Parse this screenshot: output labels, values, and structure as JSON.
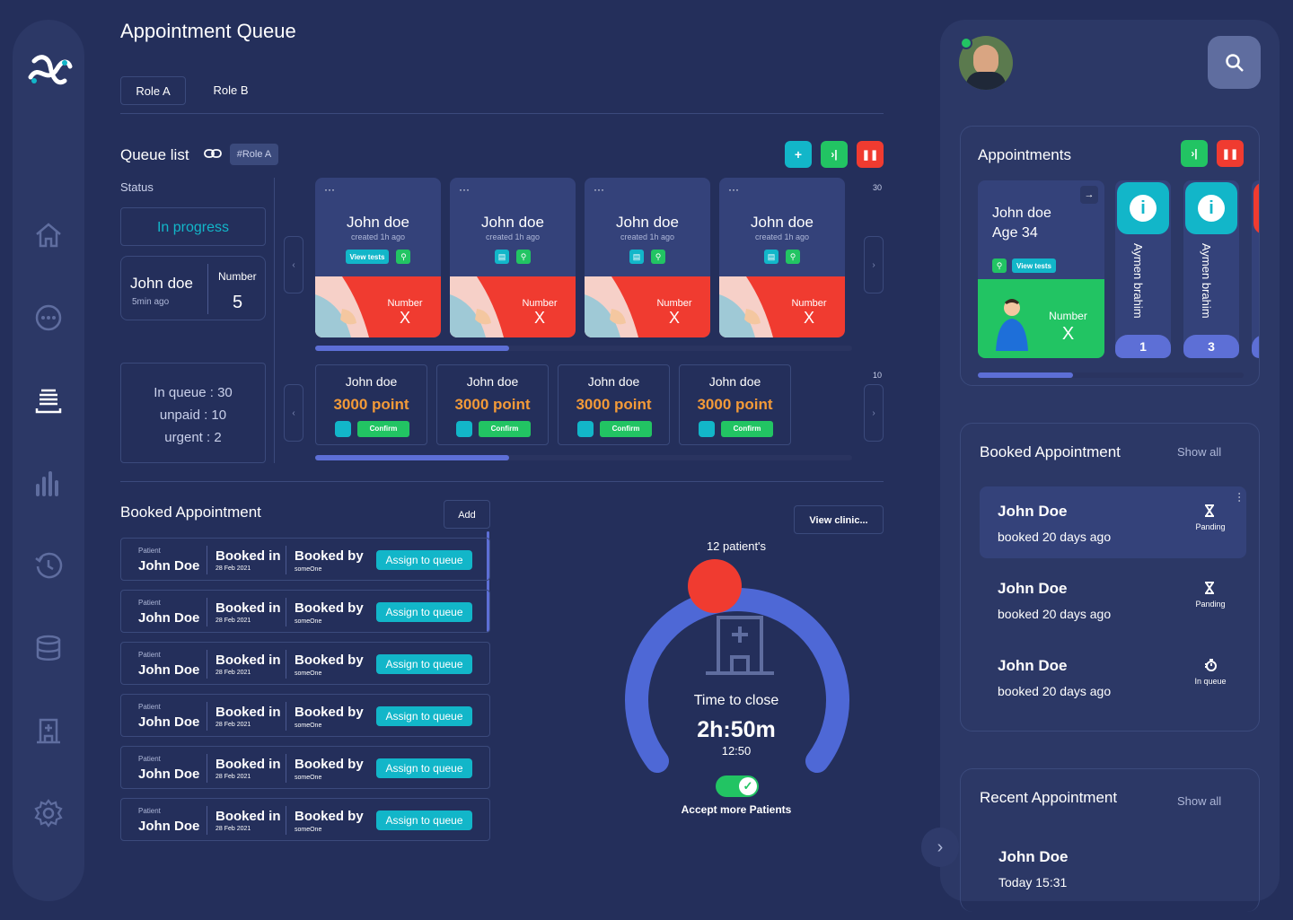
{
  "header": {
    "title": "Appointment Queue",
    "tabs": [
      {
        "label": "Role A"
      },
      {
        "label": "Role B"
      }
    ]
  },
  "queue": {
    "title": "Queue list",
    "tag": "#Role A",
    "status_label": "Status",
    "status_value": "In progress",
    "current": {
      "name": "John doe",
      "time": "5min ago",
      "number_label": "Number",
      "number": "5"
    },
    "stats": {
      "in_queue": "In queue : 30",
      "unpaid": "unpaid : 10",
      "urgent": "urgent : 2"
    },
    "top_count": "30",
    "bottom_count": "10",
    "cards": [
      {
        "name": "John doe",
        "created": "created 1h ago",
        "number_label": "Number",
        "number": "X",
        "view_tests": "View tests"
      },
      {
        "name": "John doe",
        "created": "created 1h ago",
        "number_label": "Number",
        "number": "X"
      },
      {
        "name": "John doe",
        "created": "created 1h ago",
        "number_label": "Number",
        "number": "X"
      },
      {
        "name": "John doe",
        "created": "created 1h ago",
        "number_label": "Number",
        "number": "X"
      }
    ],
    "points": [
      {
        "name": "John doe",
        "points": "3000 point",
        "confirm": "Confirm"
      },
      {
        "name": "John doe",
        "points": "3000 point",
        "confirm": "Confirm"
      },
      {
        "name": "John doe",
        "points": "3000 point",
        "confirm": "Confirm"
      },
      {
        "name": "John doe",
        "points": "3000 point",
        "confirm": "Confirm"
      }
    ]
  },
  "booked": {
    "title": "Booked Appointment",
    "add_label": "Add",
    "rows": [
      {
        "patient_label": "Patient",
        "name": "John Doe",
        "booked_in": "Booked in",
        "date": "28 Feb 2021",
        "booked_by": "Booked by",
        "by": "someOne",
        "assign": "Assign to queue"
      },
      {
        "patient_label": "Patient",
        "name": "John Doe",
        "booked_in": "Booked in",
        "date": "28 Feb 2021",
        "booked_by": "Booked by",
        "by": "someOne",
        "assign": "Assign to queue"
      },
      {
        "patient_label": "Patient",
        "name": "John Doe",
        "booked_in": "Booked in",
        "date": "28 Feb 2021",
        "booked_by": "Booked by",
        "by": "someOne",
        "assign": "Assign to queue"
      },
      {
        "patient_label": "Patient",
        "name": "John Doe",
        "booked_in": "Booked in",
        "date": "28 Feb 2021",
        "booked_by": "Booked by",
        "by": "someOne",
        "assign": "Assign to queue"
      },
      {
        "patient_label": "Patient",
        "name": "John Doe",
        "booked_in": "Booked in",
        "date": "28 Feb 2021",
        "booked_by": "Booked by",
        "by": "someOne",
        "assign": "Assign to queue"
      },
      {
        "patient_label": "Patient",
        "name": "John Doe",
        "booked_in": "Booked in",
        "date": "28 Feb 2021",
        "booked_by": "Booked by",
        "by": "someOne",
        "assign": "Assign to queue"
      }
    ]
  },
  "clinic": {
    "view_label": "View clinic...",
    "patients": "12 patient's",
    "time_label": "Time to close",
    "time_value": "2h:50m",
    "clock": "12:50",
    "accept_label": "Accept more Patients",
    "accept_on": true
  },
  "right": {
    "appointments": {
      "title": "Appointments",
      "current": {
        "name": "John doe",
        "age": "Age 34",
        "view_tests": "View tests",
        "number_label": "Number",
        "number": "X"
      },
      "side": [
        {
          "name": "Aymen brahim",
          "num": "1"
        },
        {
          "name": "Aymen brahim",
          "num": "3"
        }
      ]
    },
    "booked": {
      "title": "Booked Appointment",
      "show_all": "Show all",
      "items": [
        {
          "name": "John Doe",
          "sub": "booked  20 days ago",
          "status": "Panding",
          "icon": "hourglass-icon"
        },
        {
          "name": "John Doe",
          "sub": "booked  20 days ago",
          "status": "Panding",
          "icon": "hourglass-icon"
        },
        {
          "name": "John Doe",
          "sub": "booked  20 days ago",
          "status": "In queue",
          "icon": "stopwatch-icon"
        }
      ]
    },
    "recent": {
      "title": "Recent Appointment",
      "show_all": "Show all",
      "items": [
        {
          "name": "John Doe",
          "sub": "Today 15:31"
        }
      ]
    }
  },
  "colors": {
    "bg": "#242f5b",
    "panel": "#2c3866",
    "teal": "#12b6c9",
    "green": "#22c463",
    "red": "#f03b30",
    "orange": "#f39a38",
    "gauge": "#4e68d6"
  }
}
